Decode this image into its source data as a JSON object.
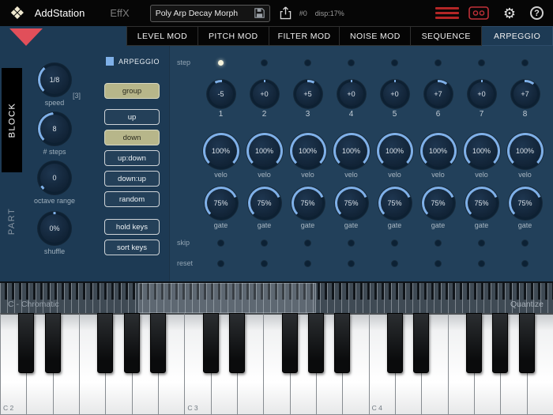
{
  "colors": {
    "accent": "#7fb0e8",
    "active_button": "#b7b68a",
    "alert_red": "#b32626",
    "triangle_red": "#e14f5a",
    "panel_bg": "#1d3a54"
  },
  "topbar": {
    "title": "AddStation",
    "subtitle": "EffX",
    "preset_name": "Poly Arp Decay Morph",
    "patch_number": "#0",
    "disp": "disp:17%",
    "icons": {
      "logo": "❖",
      "gear": "⚙",
      "help": "?"
    }
  },
  "tabs": [
    {
      "label": "LEVEL MOD",
      "active": false
    },
    {
      "label": "PITCH MOD",
      "active": false
    },
    {
      "label": "FILTER MOD",
      "active": false
    },
    {
      "label": "NOISE MOD",
      "active": false
    },
    {
      "label": "SEQUENCE",
      "active": false
    },
    {
      "label": "ARPEGGIO",
      "active": true
    }
  ],
  "side": {
    "block": "BLOCK",
    "part": "PART"
  },
  "left_panel": {
    "steps_indicator": "[3]",
    "knobs": [
      {
        "label": "speed",
        "value": "1/8",
        "arc_from": -135,
        "arc_to": -40
      },
      {
        "label": "# steps",
        "value": "8",
        "arc_from": -135,
        "arc_to": -5
      },
      {
        "label": "octave range",
        "value": "0",
        "arc_from": -135,
        "arc_to": -122
      },
      {
        "label": "shuffle",
        "value": "0%",
        "arc_from": -4,
        "arc_to": 4
      }
    ]
  },
  "arp": {
    "checkbox_label": "ARPEGGIO",
    "enabled": true,
    "buttons": [
      {
        "label": "group",
        "active": true
      },
      {
        "label": "up",
        "active": false
      },
      {
        "label": "down",
        "active": true
      },
      {
        "label": "up:down",
        "active": false
      },
      {
        "label": "down:up",
        "active": false
      },
      {
        "label": "random",
        "active": false
      },
      {
        "label": "hold keys",
        "active": false
      },
      {
        "label": "sort keys",
        "active": false
      }
    ]
  },
  "grid": {
    "row_labels": {
      "step": "step",
      "skip": "skip",
      "reset": "reset"
    },
    "velo_caption": "velo",
    "gate_caption": "gate",
    "steps": [
      {
        "num": "1",
        "pitch": "-5",
        "velo": "100%",
        "gate": "75%",
        "step_on": true,
        "skip_on": false,
        "reset_on": false
      },
      {
        "num": "2",
        "pitch": "+0",
        "velo": "100%",
        "gate": "75%",
        "step_on": false,
        "skip_on": false,
        "reset_on": false
      },
      {
        "num": "3",
        "pitch": "+5",
        "velo": "100%",
        "gate": "75%",
        "step_on": false,
        "skip_on": false,
        "reset_on": false
      },
      {
        "num": "4",
        "pitch": "+0",
        "velo": "100%",
        "gate": "75%",
        "step_on": false,
        "skip_on": false,
        "reset_on": false
      },
      {
        "num": "5",
        "pitch": "+0",
        "velo": "100%",
        "gate": "75%",
        "step_on": false,
        "skip_on": false,
        "reset_on": false
      },
      {
        "num": "6",
        "pitch": "+7",
        "velo": "100%",
        "gate": "75%",
        "step_on": false,
        "skip_on": false,
        "reset_on": false
      },
      {
        "num": "7",
        "pitch": "+0",
        "velo": "100%",
        "gate": "75%",
        "step_on": false,
        "skip_on": false,
        "reset_on": false
      },
      {
        "num": "8",
        "pitch": "+7",
        "velo": "100%",
        "gate": "75%",
        "step_on": false,
        "skip_on": false,
        "reset_on": false
      }
    ]
  },
  "keyboard": {
    "scale_label": "C - Chromatic",
    "quantize_label": "Quantize",
    "white_keys": 21,
    "octave_labels": [
      {
        "text": "C 2",
        "white_index": 0
      },
      {
        "text": "C 3",
        "white_index": 7
      },
      {
        "text": "C 4",
        "white_index": 14
      }
    ]
  }
}
